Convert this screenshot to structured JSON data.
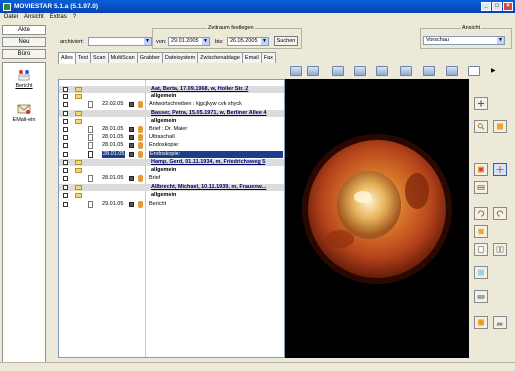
{
  "window": {
    "title": "MOVIESTAR 5.1.a (5.1.97.0)",
    "buttons": [
      "_",
      "□",
      "×"
    ]
  },
  "menu": [
    "Datei",
    "Ansicht",
    "Extras",
    "?"
  ],
  "left_nav": {
    "buttons": [
      "Akte",
      "Neu",
      "Büro"
    ],
    "items": [
      {
        "label": "Bericht",
        "icon": "report-icon"
      },
      {
        "label": "EMail-ein",
        "icon": "email-in-icon"
      }
    ]
  },
  "filter": {
    "archived_label": "archiviert:",
    "archived_value": "",
    "period_group": "Zeitraum festlegen",
    "from_label": "von:",
    "from_value": "29.01.2005",
    "to_label": "bis:",
    "to_value": "26.05.2005",
    "search_button": "Suchen",
    "view_group": "Ansicht",
    "view_value": "Vorschau"
  },
  "tabs": [
    "Alles",
    "Text",
    "Scan",
    "MultiScan",
    "Grabber",
    "Dateisystem",
    "Zwischenablage",
    "Email",
    "Fax"
  ],
  "active_tab": "Alles",
  "tree": [
    {
      "type": "patient",
      "text": "Aat, Berta, 17.09.1968, w, Holler Str. 2"
    },
    {
      "type": "group",
      "text": "allgemein"
    },
    {
      "type": "entry",
      "date": "22.02.05",
      "label": "Antwortschreiben : kjgcjkyw cvk xhyck"
    },
    {
      "type": "patient",
      "text": "Basser, Petra, 15.05.1971, w, Berliner Allee 4"
    },
    {
      "type": "group",
      "text": "allgemein"
    },
    {
      "type": "entry",
      "date": "28.01.05",
      "label": "Brief : Dr. Maier"
    },
    {
      "type": "entry",
      "date": "28.01.05",
      "label": "Ultraschall"
    },
    {
      "type": "entry",
      "date": "28.01.05",
      "label": "Endoskopie:"
    },
    {
      "type": "entry",
      "date": "28.01.05",
      "label": "Endoskopie:",
      "selected": true
    },
    {
      "type": "patient",
      "text": "Hamp, Gerd, 01.11.1934, m, Friedrichsweg 5"
    },
    {
      "type": "group",
      "text": "allgemein"
    },
    {
      "type": "entry",
      "date": "28.01.05",
      "label": "Brief"
    },
    {
      "type": "patient",
      "text": "Allbrecht, Michael, 10.11.1939, m, Frauenw..."
    },
    {
      "type": "group",
      "text": "allgemein"
    },
    {
      "type": "entry",
      "date": "29.01.05",
      "label": "Bericht"
    }
  ],
  "viewer": {
    "image": "endoscopy-image"
  },
  "colors": {
    "titlebar": "#0842b0",
    "selection": "#1c3c8c",
    "patient_row": "#dcdcdc",
    "background": "#ece9d8"
  }
}
